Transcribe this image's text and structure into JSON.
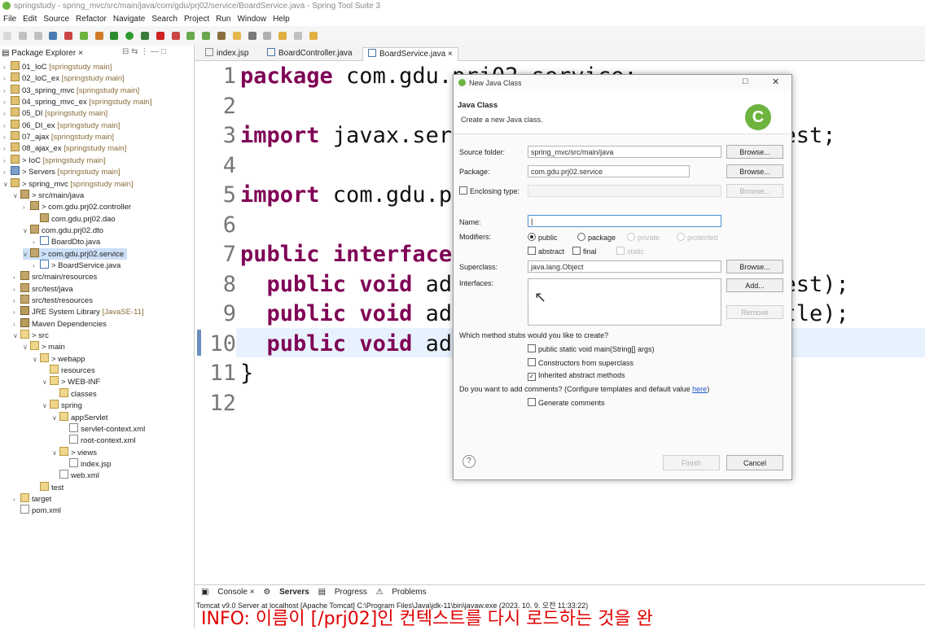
{
  "window": {
    "title": "springstudy - spring_mvc/src/main/java/com/gdu/prj02/service/BoardService.java - Spring Tool Suite 3"
  },
  "menu": [
    "File",
    "Edit",
    "Source",
    "Refactor",
    "Navigate",
    "Search",
    "Project",
    "Run",
    "Window",
    "Help"
  ],
  "package_explorer": {
    "title": "Package Explorer",
    "items": [
      {
        "label": "01_IoC",
        "dec": " [springstudy main]",
        "tw": ">",
        "icon": "proj"
      },
      {
        "label": "02_IoC_ex",
        "dec": " [springstudy main]",
        "tw": ">",
        "icon": "proj"
      },
      {
        "label": "03_spring_mvc",
        "dec": " [springstudy main]",
        "tw": ">",
        "icon": "proj"
      },
      {
        "label": "04_spring_mvc_ex",
        "dec": " [springstudy main]",
        "tw": ">",
        "icon": "proj"
      },
      {
        "label": "05_DI",
        "dec": " [springstudy main]",
        "tw": ">",
        "icon": "proj"
      },
      {
        "label": "06_DI_ex",
        "dec": " [springstudy main]",
        "tw": ">",
        "icon": "proj"
      },
      {
        "label": "07_ajax",
        "dec": " [springstudy main]",
        "tw": ">",
        "icon": "proj"
      },
      {
        "label": "08_ajax_ex",
        "dec": " [springstudy main]",
        "tw": ">",
        "icon": "proj"
      },
      {
        "label": "> IoC",
        "dec": " [springstudy main]",
        "tw": ">",
        "icon": "proj"
      },
      {
        "label": "> Servers",
        "dec": " [springstudy main]",
        "tw": ">",
        "icon": "srvr"
      },
      {
        "label": "> spring_mvc",
        "dec": " [springstudy main]",
        "tw": "v",
        "icon": "proj"
      },
      {
        "label": "> src/main/java",
        "dec": "",
        "tw": "v",
        "icon": "pkg"
      },
      {
        "label": "> com.gdu.prj02.controller",
        "dec": "",
        "tw": ">",
        "icon": "pkg"
      },
      {
        "label": "com.gdu.prj02.dao",
        "dec": "",
        "tw": "",
        "icon": "pkg"
      },
      {
        "label": "com.gdu.prj02.dto",
        "dec": "",
        "tw": "v",
        "icon": "pkg"
      },
      {
        "label": "BoardDto.java",
        "dec": "",
        "tw": ">",
        "icon": "java"
      },
      {
        "label": "> com.gdu.prj02.service",
        "dec": "",
        "tw": "v",
        "icon": "pkg"
      },
      {
        "label": "> BoardService.java",
        "dec": "",
        "tw": ">",
        "icon": "java"
      },
      {
        "label": "src/main/resources",
        "dec": "",
        "tw": ">",
        "icon": "pkg"
      },
      {
        "label": "src/test/java",
        "dec": "",
        "tw": ">",
        "icon": "pkg"
      },
      {
        "label": "src/test/resources",
        "dec": "",
        "tw": ">",
        "icon": "pkg"
      },
      {
        "label": "JRE System Library",
        "dec": " [JavaSE-11]",
        "tw": ">",
        "icon": "lib"
      },
      {
        "label": "Maven Dependencies",
        "dec": "",
        "tw": ">",
        "icon": "lib"
      },
      {
        "label": "> src",
        "dec": "",
        "tw": "v",
        "icon": "folder"
      },
      {
        "label": "> main",
        "dec": "",
        "tw": "v",
        "icon": "folder"
      },
      {
        "label": "> webapp",
        "dec": "",
        "tw": "v",
        "icon": "folder"
      },
      {
        "label": "resources",
        "dec": "",
        "tw": "",
        "icon": "folder"
      },
      {
        "label": "> WEB-INF",
        "dec": "",
        "tw": "v",
        "icon": "folder"
      },
      {
        "label": "classes",
        "dec": "",
        "tw": "",
        "icon": "folder"
      },
      {
        "label": "spring",
        "dec": "",
        "tw": "v",
        "icon": "folder"
      },
      {
        "label": "appServlet",
        "dec": "",
        "tw": "v",
        "icon": "folder"
      },
      {
        "label": "servlet-context.xml",
        "dec": "",
        "tw": "",
        "icon": "file"
      },
      {
        "label": "root-context.xml",
        "dec": "",
        "tw": "",
        "icon": "file"
      },
      {
        "label": "> views",
        "dec": "",
        "tw": "v",
        "icon": "folder"
      },
      {
        "label": "index.jsp",
        "dec": "",
        "tw": "",
        "icon": "file"
      },
      {
        "label": "web.xml",
        "dec": "",
        "tw": "",
        "icon": "file"
      },
      {
        "label": "test",
        "dec": "",
        "tw": "",
        "icon": "folder"
      },
      {
        "label": "target",
        "dec": "",
        "tw": ">",
        "icon": "folder"
      },
      {
        "label": "pom.xml",
        "dec": "",
        "tw": "",
        "icon": "file"
      }
    ]
  },
  "editor": {
    "tabs": [
      "index.jsp",
      "BoardController.java",
      "BoardService.java"
    ],
    "active_tab": 2,
    "lines": [
      {
        "n": "1",
        "code": "package com.gdu.prj02.service;"
      },
      {
        "n": "2",
        "code": ""
      },
      {
        "n": "3",
        "code": "import javax.servlet.http.HttpServletRequest;"
      },
      {
        "n": "4",
        "code": ""
      },
      {
        "n": "5",
        "code": "import com.gdu.prj02.dto.BoardDto;"
      },
      {
        "n": "6",
        "code": ""
      },
      {
        "n": "7",
        "code": "public interface BoardService {"
      },
      {
        "n": "8",
        "code": "  public void add(HttpServletRequest request);"
      },
      {
        "n": "9",
        "code": "  public void add2(int boardNo, String title);"
      },
      {
        "n": "10",
        "code": "  public void add3(BoardDto boardDto);"
      },
      {
        "n": "11",
        "code": "}"
      },
      {
        "n": "12",
        "code": ""
      }
    ]
  },
  "console": {
    "tabs": [
      "Console",
      "Servers",
      "Progress",
      "Problems"
    ],
    "info": "Tomcat v9.0 Server at localhost [Apache Tomcat] C:\\Program Files\\Java\\jdk-11\\bin\\javaw.exe  (2023. 10. 9. 오전 11:33:22)",
    "text": "INFO: 이름이 [/prj02]인 컨텍스트를 다시 로드하는 것을 완"
  },
  "dialog": {
    "title": "New Java Class",
    "heading": "Java Class",
    "description": "Create a new Java class.",
    "source_folder_label": "Source folder:",
    "source_folder": "spring_mvc/src/main/java",
    "package_label": "Package:",
    "package": "com.gdu.prj02.service",
    "enclosing_label": "Enclosing type:",
    "name_label": "Name:",
    "name": "",
    "modifiers_label": "Modifiers:",
    "mod_public": "public",
    "mod_package": "package",
    "mod_private": "private",
    "mod_protected": "protected",
    "mod_abstract": "abstract",
    "mod_final": "final",
    "mod_static": "static",
    "superclass_label": "Superclass:",
    "superclass": "java.lang.Object",
    "interfaces_label": "Interfaces:",
    "browse": "Browse...",
    "add": "Add...",
    "remove": "Remove",
    "stubs_question": "Which method stubs would you like to create?",
    "stub_main": "public static void main(String[] args)",
    "stub_constructors": "Constructors from superclass",
    "stub_inherited": "Inherited abstract methods",
    "comments_question": "Do you want to add comments? (Configure templates and default value ",
    "comments_link": "here",
    "comments_close": ")",
    "generate_comments": "Generate comments",
    "finish": "Finish",
    "cancel": "Cancel"
  }
}
